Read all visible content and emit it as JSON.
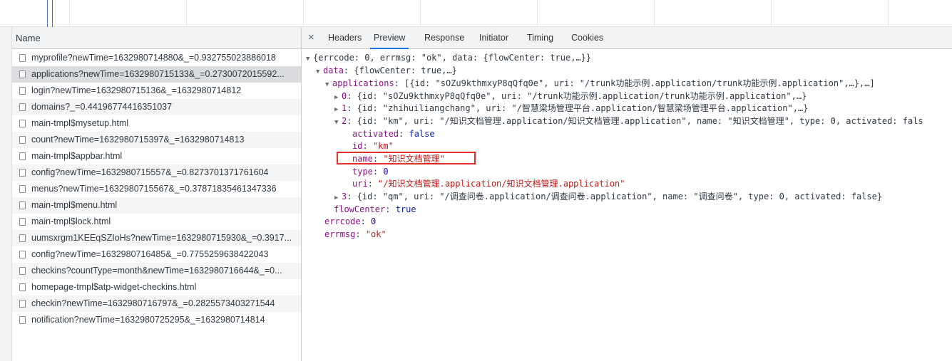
{
  "name_panel": {
    "header": "Name",
    "requests": [
      "myprofile?newTime=1632980714880&_=0.932755023886018",
      "applications?newTime=1632980715133&_=0.2730072015592...",
      "login?newTime=1632980715136&_=1632980714812",
      "domains?_=0.44196774416351037",
      "main-tmpl$mysetup.html",
      "count?newTime=1632980715397&_=1632980714813",
      "main-tmpl$appbar.html",
      "config?newTime=1632980715557&_=0.8273701371761604",
      "menus?newTime=1632980715567&_=0.37871835461347336",
      "main-tmpl$menu.html",
      "main-tmpl$lock.html",
      "uumsxrgm1KEEqSZIoHs?newTime=1632980715930&_=0.3917...",
      "config?newTime=1632980716485&_=0.7755259638422043",
      "checkins?countType=month&newTime=1632980716644&_=0...",
      "homepage-tmpl$atp-widget-checkins.html",
      "checkin?newTime=1632980716797&_=0.2825573403271544",
      "notification?newTime=1632980725295&_=1632980714814"
    ],
    "selected_index": 1
  },
  "detail_tabs": {
    "close": "×",
    "headers": "Headers",
    "preview": "Preview",
    "response": "Response",
    "initiator": "Initiator",
    "timing": "Timing",
    "cookies": "Cookies",
    "active": "Preview"
  },
  "preview": {
    "root": "{errcode: 0, errmsg: \"ok\", data: {flowCenter: true,…}}",
    "data_key": "data",
    "data_summary": "{flowCenter: true,…}",
    "applications_key": "applications",
    "applications_summary": "[{id: \"sOZu9kthmxyP8qQfq0e\", uri: \"/trunk功能示例.application/trunk功能示例.application\",…},…]",
    "item0_key": "0",
    "item0_summary": "{id: \"sOZu9kthmxyP8qQfq0e\", uri: \"/trunk功能示例.application/trunk功能示例.application\",…}",
    "item1_key": "1",
    "item1_summary": "{id: \"zhihuiliangchang\", uri: \"/智慧梁场管理平台.application/智慧梁场管理平台.application\",…}",
    "item2_key": "2",
    "item2_summary": "{id: \"km\", uri: \"/知识文档管理.application/知识文档管理.application\", name: \"知识文档管理\", type: 0, activated: fals",
    "activated_key": "activated",
    "activated_val": "false",
    "id_key": "id",
    "id_val": "\"km\"",
    "name_key": "name",
    "name_val": "\"知识文档管理\"",
    "type_key": "type",
    "type_val": "0",
    "uri_key": "uri",
    "uri_val": "\"/知识文档管理.application/知识文档管理.application\"",
    "item3_key": "3",
    "item3_summary": "{id: \"qm\", uri: \"/调查问卷.application/调查问卷.application\", name: \"调查问卷\", type: 0, activated: false}",
    "flowcenter_key": "flowCenter",
    "flowcenter_val": "true",
    "errcode_key": "errcode",
    "errcode_val": "0",
    "errmsg_key": "errmsg",
    "errmsg_val": "\"ok\""
  },
  "icons": {
    "file": "file-icon",
    "expanded": "triangle-down-icon",
    "collapsed": "triangle-right-icon"
  }
}
